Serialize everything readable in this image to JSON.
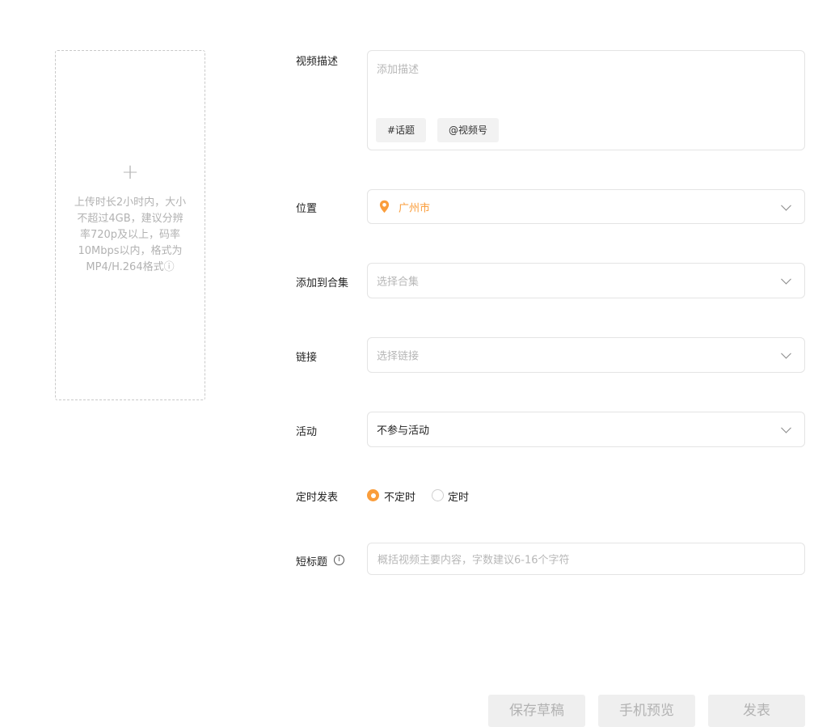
{
  "upload": {
    "plus": "+",
    "hint": "上传时长2小时内，大小不超过4GB，建议分辨率720p及以上，码率10Mbps以内，格式为MP4/H.264格式ⓘ"
  },
  "description": {
    "label": "视频描述",
    "placeholder": "添加描述",
    "topic_chip": "#话题",
    "mention_chip": "@视频号"
  },
  "location": {
    "label": "位置",
    "value": "广州市",
    "value_color": "#fa9d3b"
  },
  "collection": {
    "label": "添加到合集",
    "placeholder": "选择合集"
  },
  "link": {
    "label": "链接",
    "placeholder": "选择链接"
  },
  "activity": {
    "label": "活动",
    "value": "不参与活动"
  },
  "schedule": {
    "label": "定时发表",
    "options": [
      "不定时",
      "定时"
    ],
    "selected": "不定时",
    "accent": "#fa9d3b"
  },
  "short_title": {
    "label": "短标题",
    "info_icon": "i",
    "placeholder": "概括视频主要内容，字数建议6-16个字符"
  },
  "actions": {
    "save_draft": "保存草稿",
    "preview": "手机预览",
    "publish": "发表"
  }
}
